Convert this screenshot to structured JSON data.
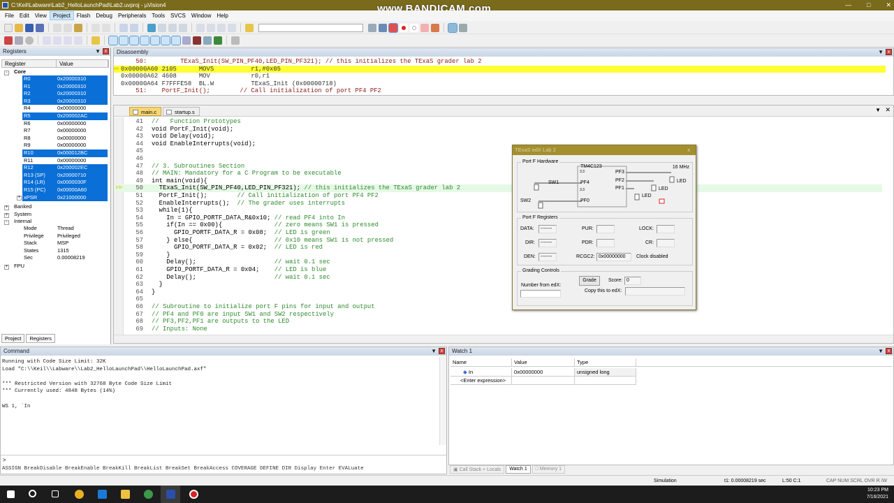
{
  "window": {
    "title": "C:\\Keil\\Labware\\Lab2_HelloLaunchPad\\Lab2.uvproj - µVision4",
    "watermark": "www.BANDICAM.com"
  },
  "menu": [
    "File",
    "Edit",
    "View",
    "Project",
    "Flash",
    "Debug",
    "Peripherals",
    "Tools",
    "SVCS",
    "Window",
    "Help"
  ],
  "registers": {
    "title": "Registers",
    "col_register": "Register",
    "col_value": "Value",
    "core": "Core",
    "rows": [
      {
        "name": "R0",
        "value": "0x20000310",
        "sel": true
      },
      {
        "name": "R1",
        "value": "0x20000310",
        "sel": true
      },
      {
        "name": "R2",
        "value": "0x20000310",
        "sel": true
      },
      {
        "name": "R3",
        "value": "0x20000310",
        "sel": true
      },
      {
        "name": "R4",
        "value": "0x00000000",
        "sel": false
      },
      {
        "name": "R5",
        "value": "0x200002AC",
        "sel": true
      },
      {
        "name": "R6",
        "value": "0x00000000",
        "sel": false
      },
      {
        "name": "R7",
        "value": "0x00000000",
        "sel": false
      },
      {
        "name": "R8",
        "value": "0x00000000",
        "sel": false
      },
      {
        "name": "R9",
        "value": "0x00000000",
        "sel": false
      },
      {
        "name": "R10",
        "value": "0x000012BC",
        "sel": true
      },
      {
        "name": "R11",
        "value": "0x00000000",
        "sel": false
      },
      {
        "name": "R12",
        "value": "0x200002EC",
        "sel": true
      },
      {
        "name": "R13 (SP)",
        "value": "0x20000710",
        "sel": true
      },
      {
        "name": "R14 (LR)",
        "value": "0x0000030F",
        "sel": true
      },
      {
        "name": "R15 (PC)",
        "value": "0x00000A60",
        "sel": true
      },
      {
        "name": "xPSR",
        "value": "0x21000000",
        "sel": true
      }
    ],
    "groups": [
      "Banked",
      "System",
      "Internal"
    ],
    "internal": [
      {
        "name": "Mode",
        "value": "Thread"
      },
      {
        "name": "Privilege",
        "value": "Privileged"
      },
      {
        "name": "Stack",
        "value": "MSP"
      },
      {
        "name": "States",
        "value": "1315"
      },
      {
        "name": "Sec",
        "value": "0.00008219"
      }
    ],
    "fpu": "FPU",
    "tabs": [
      "Project",
      "Registers"
    ]
  },
  "disassembly": {
    "title": "Disassembly",
    "lines": [
      {
        "text": "    50:         TExaS_Init(SW_PIN_PF40,LED_PIN_PF321); // this initializes the TExaS grader lab 2",
        "kind": "src"
      },
      {
        "text": "0x00000A60 2105      MOVS          r1,#0x05",
        "kind": "cur"
      },
      {
        "text": "0x00000A62 4608      MOV           r0,r1",
        "kind": "asm"
      },
      {
        "text": "0x00000A64 F7FFFE58  BL.W          TExaS_Init (0x00000718)",
        "kind": "asm"
      },
      {
        "text": "    51:    PortF_Init();        // Call initialization of port PF4 PF2",
        "kind": "src"
      }
    ]
  },
  "editor": {
    "tabs": [
      "main.c",
      "startup.s"
    ],
    "lines": [
      {
        "n": "41",
        "code": "",
        "cmt": "//   Function Prototypes"
      },
      {
        "n": "42",
        "code": "void PortF_Init(void);",
        "cmt": ""
      },
      {
        "n": "43",
        "code": "void Delay(void);",
        "cmt": ""
      },
      {
        "n": "44",
        "code": "void EnableInterrupts(void);",
        "cmt": ""
      },
      {
        "n": "45",
        "code": "",
        "cmt": ""
      },
      {
        "n": "46",
        "code": "",
        "cmt": ""
      },
      {
        "n": "47",
        "code": "",
        "cmt": "// 3. Subroutines Section"
      },
      {
        "n": "48",
        "code": "",
        "cmt": "// MAIN: Mandatory for a C Program to be executable"
      },
      {
        "n": "49",
        "code": "int main(void){",
        "cmt": ""
      },
      {
        "n": "50",
        "code": "  TExaS_Init(SW_PIN_PF40,LED_PIN_PF321); ",
        "cmt": "// this initializes the TExaS grader lab 2"
      },
      {
        "n": "51",
        "code": "  PortF_Init();        ",
        "cmt": "// Call initialization of port PF4 PF2"
      },
      {
        "n": "52",
        "code": "  EnableInterrupts();  ",
        "cmt": "// The grader uses interrupts"
      },
      {
        "n": "53",
        "code": "  while(1){",
        "cmt": ""
      },
      {
        "n": "54",
        "code": "    In = GPIO_PORTF_DATA_R&0x10; ",
        "cmt": "// read PF4 into In"
      },
      {
        "n": "55",
        "code": "    if(In == 0x00){              ",
        "cmt": "// zero means SW1 is pressed"
      },
      {
        "n": "56",
        "code": "      GPIO_PORTF_DATA_R = 0x08;  ",
        "cmt": "// LED is green"
      },
      {
        "n": "57",
        "code": "    } else{                      ",
        "cmt": "// 0x10 means SW1 is not pressed"
      },
      {
        "n": "58",
        "code": "      GPIO_PORTF_DATA_R = 0x02;  ",
        "cmt": "// LED is red"
      },
      {
        "n": "59",
        "code": "    }",
        "cmt": ""
      },
      {
        "n": "60",
        "code": "    Delay();                     ",
        "cmt": "// wait 0.1 sec"
      },
      {
        "n": "61",
        "code": "    GPIO_PORTF_DATA_R = 0x04;    ",
        "cmt": "// LED is blue"
      },
      {
        "n": "62",
        "code": "    Delay();                     ",
        "cmt": "// wait 0.1 sec"
      },
      {
        "n": "63",
        "code": "  }",
        "cmt": ""
      },
      {
        "n": "64",
        "code": "}",
        "cmt": ""
      },
      {
        "n": "65",
        "code": "",
        "cmt": ""
      },
      {
        "n": "66",
        "code": "",
        "cmt": "// Subroutine to initialize port F pins for input and output"
      },
      {
        "n": "67",
        "code": "",
        "cmt": "// PF4 and PF0 are input SW1 and SW2 respectively"
      },
      {
        "n": "68",
        "code": "",
        "cmt": "// PF3,PF2,PF1 are outputs to the LED"
      },
      {
        "n": "69",
        "code": "",
        "cmt": "// Inputs: None"
      }
    ]
  },
  "texas": {
    "title": "TExaS edX Lab 2",
    "close": "x",
    "hw_group": "Port F Hardware",
    "chip": "TM4C123",
    "freq": "16 MHz",
    "sw1": "SW1",
    "sw2": "SW2",
    "pf4": "PF4",
    "pf0": "PF0",
    "pf3": "PF3",
    "pf2": "PF2",
    "pf1": "PF1",
    "led": "LED",
    "v33": "3.3",
    "reg_group": "Port F Registers",
    "data": "DATA:",
    "dir": "DIR:",
    "den": "DEN:",
    "pur": "PUR:",
    "pdr": "PDR:",
    "rcgc2": "RCGC2:",
    "lock": "LOCK:",
    "cr": "CR:",
    "dash_val": "-------",
    "rcgc2_val": "0x00000000",
    "clock": "Clock disabled",
    "grading_group": "Grading Controls",
    "grade_btn": "Grade",
    "score_lbl": "Score:",
    "score": "0",
    "number_lbl": "Number from edX:",
    "copy_lbl": "Copy this to edX:"
  },
  "command": {
    "title": "Command",
    "output": "Running with Code Size Limit: 32K\nLoad \"C:\\\\Keil\\\\Labware\\\\Lab2_HelloLaunchPad\\\\HelloLaunchPad.axf\"\n\n*** Restricted Version with 32768 Byte Code Size Limit\n*** Currently used: 4848 Bytes (14%)\n\nWS 1, `In",
    "prompt": ">",
    "help": "ASSIGN BreakDisable BreakEnable BreakKill BreakList BreakSet BreakAccess COVERAGE DEFINE DIR Display Enter EVALuate"
  },
  "watch": {
    "title": "Watch 1",
    "cols": [
      "Name",
      "Value",
      "Type"
    ],
    "rows": [
      {
        "name": "In",
        "value": "0x00000000",
        "type": "unsigned long"
      }
    ],
    "enter": "<Enter expression>",
    "tabs": [
      "Call Stack + Locals",
      "Watch 1",
      "Memory 1"
    ]
  },
  "status": {
    "mode": "Simulation",
    "time": "t1: 0.00008219 sec",
    "pos": "L:50 C:1",
    "flags": "CAP  NUM  SCRL  OVR  R /W"
  },
  "taskbar": {
    "time": "10:23 PM",
    "date": "7/16/2021"
  }
}
